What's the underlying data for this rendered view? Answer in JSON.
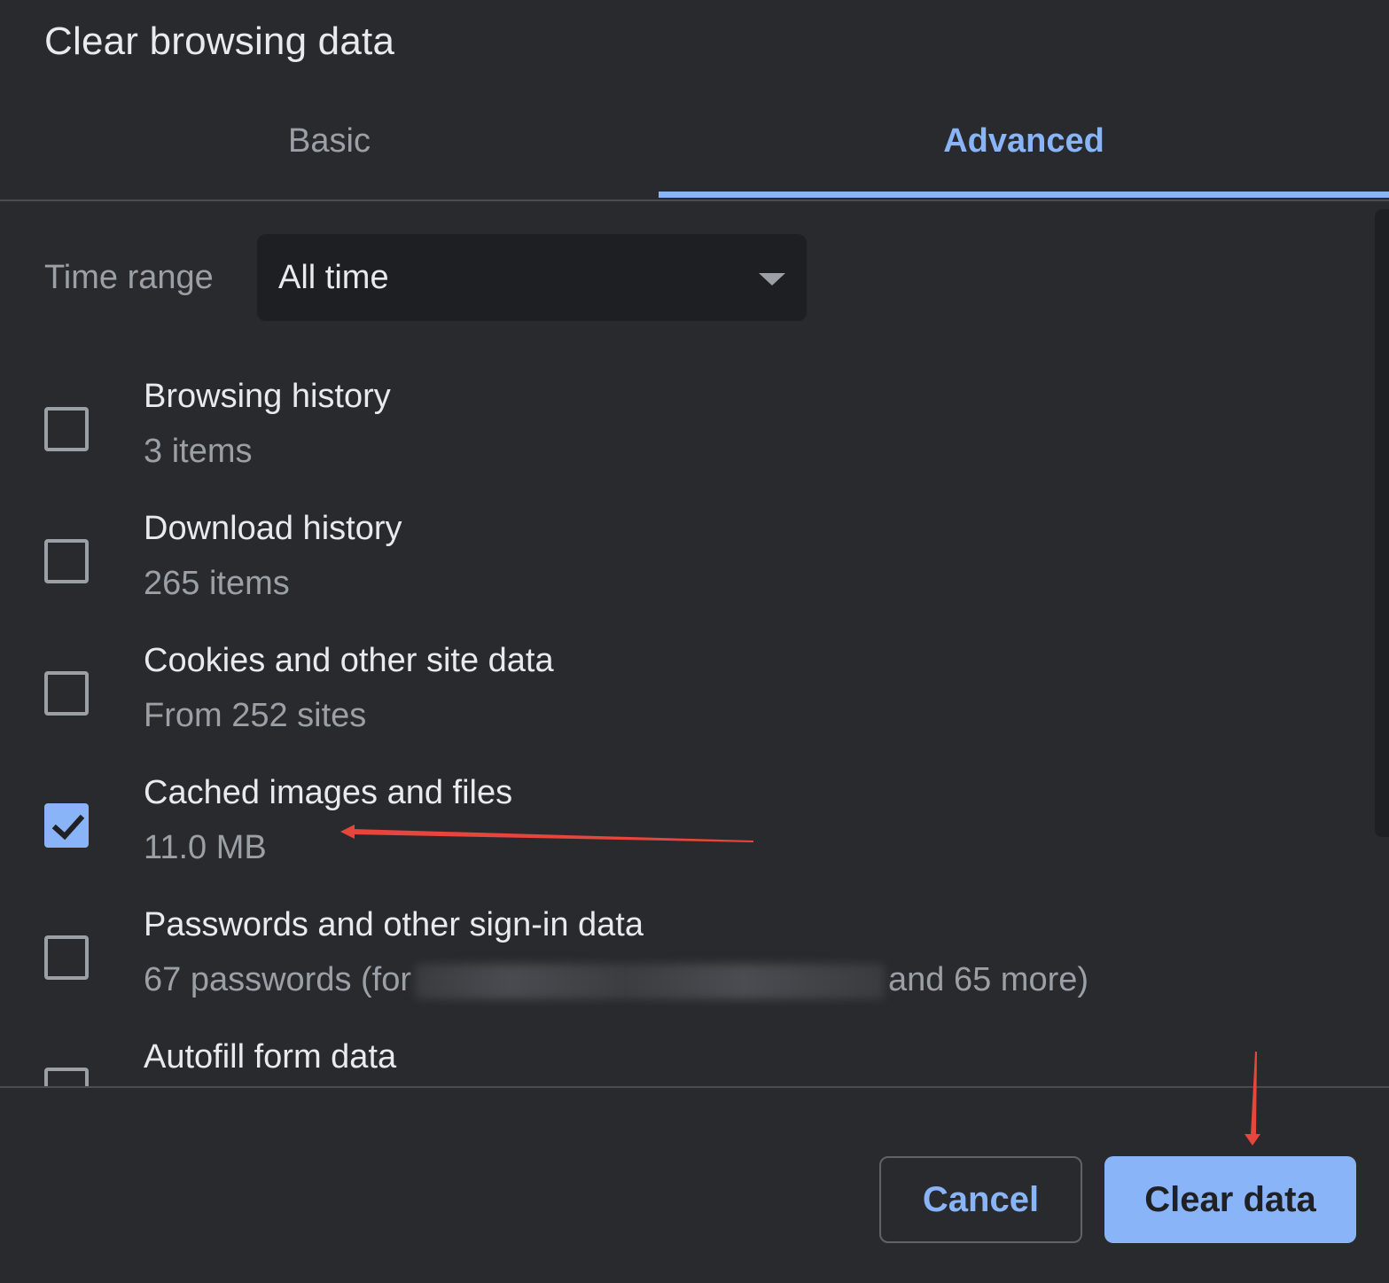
{
  "dialog": {
    "title": "Clear browsing data"
  },
  "tabs": [
    {
      "label": "Basic",
      "active": false
    },
    {
      "label": "Advanced",
      "active": true
    }
  ],
  "time_range": {
    "label": "Time range",
    "value": "All time"
  },
  "options": [
    {
      "title": "Browsing history",
      "detail": "3 items",
      "checked": false
    },
    {
      "title": "Download history",
      "detail": "265 items",
      "checked": false
    },
    {
      "title": "Cookies and other site data",
      "detail": "From 252 sites",
      "checked": false
    },
    {
      "title": "Cached images and files",
      "detail": "11.0 MB",
      "checked": true
    },
    {
      "title": "Passwords and other sign-in data",
      "detail_prefix": "67 passwords (for",
      "detail_suffix": "and 65 more)",
      "checked": false
    },
    {
      "title": "Autofill form data",
      "checked": false
    }
  ],
  "buttons": {
    "cancel": "Cancel",
    "clear": "Clear data"
  },
  "colors": {
    "background": "#292a2d",
    "accent": "#8ab4f8",
    "annotation_arrow": "#e8453c"
  },
  "icons": {
    "dropdown": "caret-down-icon",
    "check": "checkmark-icon"
  }
}
